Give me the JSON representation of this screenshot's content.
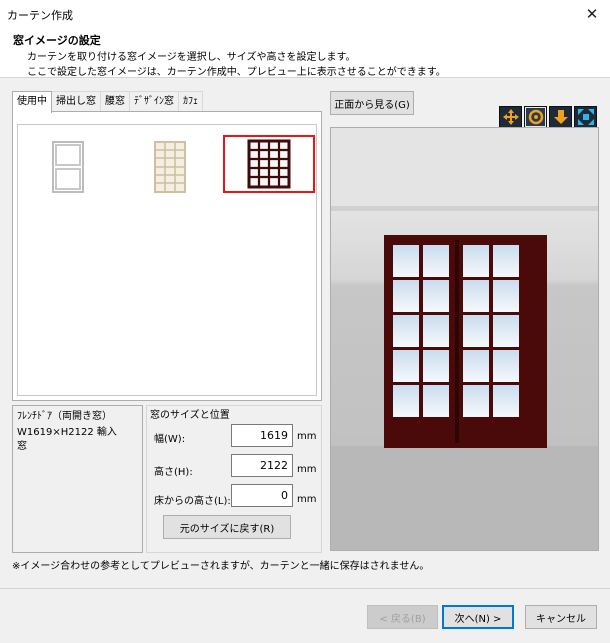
{
  "window": {
    "title": "カーテン作成",
    "close_icon": "close-icon"
  },
  "header": {
    "title": "窓イメージの設定",
    "line1": "カーテンを取り付ける窓イメージを選択し、サイズや高さを設定します。",
    "line2": "ここで設定した窓イメージは、カーテン作成中、プレビュー上に表示させることができます。"
  },
  "tabs": [
    {
      "label": "使用中",
      "active": true
    },
    {
      "label": "掃出し窓"
    },
    {
      "label": "腰窓"
    },
    {
      "label": "ﾃﾞｻﾞｲﾝ窓"
    },
    {
      "label": "ｶﾌｪ"
    }
  ],
  "thumbnails": [
    {
      "name": "white-double-hung-window",
      "frame_color": "#c8c8c8",
      "selected": false
    },
    {
      "name": "beige-grid-window",
      "frame_color": "#d3c6a6",
      "selected": false
    },
    {
      "name": "french-door-window",
      "frame_color": "#3d0b0b",
      "selected": true
    }
  ],
  "info": {
    "name": "ﾌﾚﾝﾁﾄﾞｱ（両開き窓）",
    "size_line": "W1619×H2122  輸入",
    "size_line2": "窓"
  },
  "size": {
    "group_title": "窓のサイズと位置",
    "width_label": "幅(W):",
    "width_value": "1619",
    "height_label": "高さ(H):",
    "height_value": "2122",
    "floor_label": "床からの高さ(L):",
    "floor_value": "0",
    "unit": "mm",
    "reset_button": "元のサイズに戻す(R)"
  },
  "preview": {
    "front_view_button": "正面から見る(G)",
    "tools": [
      {
        "icon": "move-arrows-icon"
      },
      {
        "icon": "rotate-icon",
        "active": true
      },
      {
        "icon": "down-arrow-icon"
      },
      {
        "icon": "fit-view-icon"
      }
    ],
    "wall_color": "#c3c3c3",
    "frame_color": "#4a0a0a"
  },
  "note": "※イメージ合わせの参考としてプレビューされますが、カーテンと一緒に保存はされません。",
  "footer": {
    "back_button": "< 戻る(B)",
    "next_button": "次へ(N) >",
    "cancel_button": "キャンセル"
  }
}
